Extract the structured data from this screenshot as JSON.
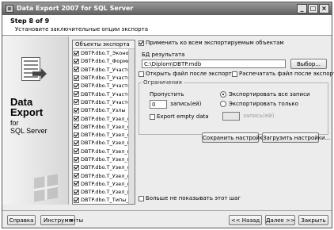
{
  "window": {
    "title": "Data Export 2007 for SQL Server"
  },
  "header": {
    "step": "Step 8 of 9",
    "subtitle": "Установите заключительные опции экспорта"
  },
  "brand": {
    "title_line1": "Data",
    "title_line2": "Export",
    "for": "for",
    "product": "SQL Server"
  },
  "objects": {
    "header": "Объекты экспорта",
    "items": [
      "DBTP.dbo.T_Эконом",
      "DBTP.dbo.T_Формы",
      "DBTP.dbo.T_Участок",
      "DBTP.dbo.T_Участок",
      "DBTP.dbo.T_Участок",
      "DBTP.dbo.T_Участок",
      "DBTP.dbo.T_Участок",
      "DBTP.dbo.T_Узлы",
      "DBTP.dbo.T_Узел_сс",
      "DBTP.dbo.T_Узел_сс",
      "DBTP.dbo.T_Узел_сс",
      "DBTP.dbo.T_Узел_пр",
      "DBTP.dbo.T_Узел_пр",
      "DBTP.dbo.T_Узел_пр",
      "DBTP.dbo.T_Узел_сс",
      "DBTP.dbo.T_Узел_сс",
      "DBTP.dbo.T_Узел_сс",
      "DBTP.dbo.T_Узел_и",
      "DBTP.dbo.T_Типы_у",
      "DBTP.dbo.T_Типы_у",
      "DBTP.dbo.T_Типы_R",
      "DBTP.dbo.T_Типы_и",
      "DBTP.dbo.T_Типы_ж"
    ]
  },
  "options": {
    "apply_all": "Применить ко всем экспортируемым объектам",
    "result_db_label": "БД результата",
    "result_db_path": "C:\\Diplom\\DBTP.mdb",
    "browse": "Выбор...",
    "open_after": "Открыть файл после экспорта",
    "print_after": "Распечатать файл после экспорта",
    "limits_title": "Ограничения",
    "skip_label": "Пропустить",
    "skip_value": "0",
    "records_unit": "запись(ей)",
    "export_all": "Экспортировать все записи",
    "export_only": "Экспортировать только",
    "only_value": "",
    "only_unit": "запись(ей)",
    "export_empty": "Export empty data",
    "save_settings": "Сохранить настройки...",
    "load_settings": "Загрузить настройки...",
    "dont_show": "Больше не показывать этот шаг"
  },
  "footer": {
    "help": "Справка",
    "tools": "Инструменты",
    "back": "<< Назад",
    "next": "Далее >>",
    "close": "Закрыть"
  }
}
